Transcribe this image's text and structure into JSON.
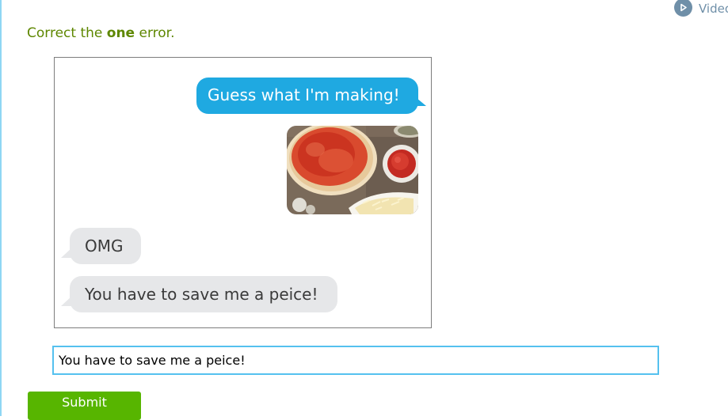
{
  "video_link": {
    "label": "Video",
    "icon": "play-circle-icon",
    "color": "#6f8fa8"
  },
  "instruction": {
    "before": "Correct the ",
    "emphasis": "one",
    "after": " error.",
    "color": "#5e8700"
  },
  "conversation": {
    "outgoing_message": "Guess what I'm making!",
    "outgoing_color": "#1fa9e1",
    "photo_subject": "pizza dough with tomato sauce and cheese",
    "incoming_messages": [
      "OMG",
      "You have to save me a peice!"
    ],
    "incoming_color": "#e6e7e9"
  },
  "answer": {
    "value": "You have to save me a peice!"
  },
  "submit": {
    "label": "Submit",
    "color": "#57b500"
  }
}
